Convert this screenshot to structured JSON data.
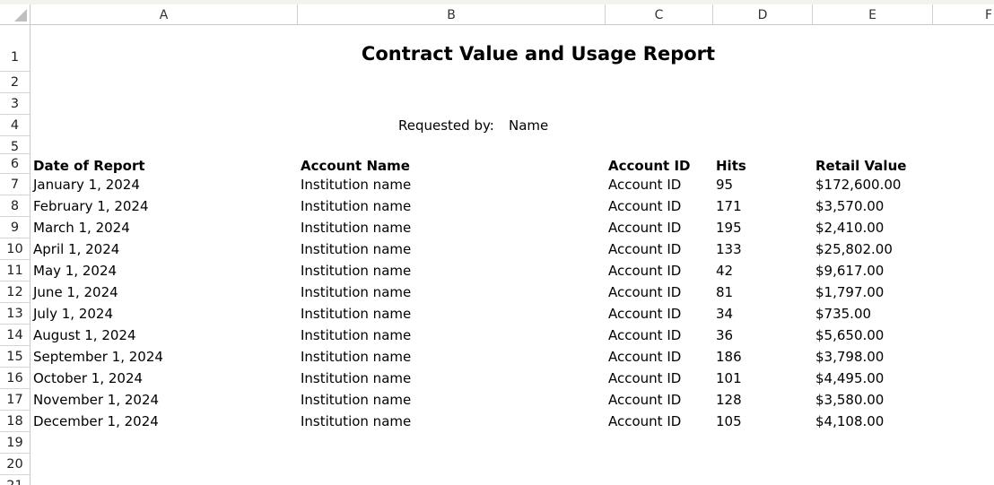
{
  "corner": {
    "icon": "select-all-triangle-icon"
  },
  "columns": [
    "A",
    "B",
    "C",
    "D",
    "E",
    "F"
  ],
  "rows": [
    "1",
    "2",
    "3",
    "4",
    "5",
    "6",
    "7",
    "8",
    "9",
    "10",
    "11",
    "12",
    "13",
    "14",
    "15",
    "16",
    "17",
    "18",
    "19",
    "20",
    "21"
  ],
  "report": {
    "title": "Contract Value and Usage Report",
    "requested_by_label": "Requested by:",
    "requested_by_value": "Name"
  },
  "table": {
    "headers": {
      "date": "Date of Report",
      "account_name": "Account Name",
      "account_id": "Account ID",
      "hits": "Hits",
      "retail_value": "Retail Value"
    },
    "rows": [
      {
        "date": "January 1, 2024",
        "account_name": "Institution name",
        "account_id": "Account ID",
        "hits": "95",
        "retail_value": "$172,600.00"
      },
      {
        "date": "February 1, 2024",
        "account_name": "Institution name",
        "account_id": "Account ID",
        "hits": "171",
        "retail_value": "$3,570.00"
      },
      {
        "date": "March 1, 2024",
        "account_name": "Institution name",
        "account_id": "Account ID",
        "hits": "195",
        "retail_value": "$2,410.00"
      },
      {
        "date": "April 1, 2024",
        "account_name": "Institution name",
        "account_id": "Account ID",
        "hits": "133",
        "retail_value": "$25,802.00"
      },
      {
        "date": "May 1, 2024",
        "account_name": "Institution name",
        "account_id": "Account ID",
        "hits": "42",
        "retail_value": "$9,617.00"
      },
      {
        "date": "June 1, 2024",
        "account_name": "Institution name",
        "account_id": "Account ID",
        "hits": "81",
        "retail_value": "$1,797.00"
      },
      {
        "date": "July 1, 2024",
        "account_name": "Institution name",
        "account_id": "Account ID",
        "hits": "34",
        "retail_value": "$735.00"
      },
      {
        "date": "August 1, 2024",
        "account_name": "Institution name",
        "account_id": "Account ID",
        "hits": "36",
        "retail_value": "$5,650.00"
      },
      {
        "date": "September 1, 2024",
        "account_name": "Institution name",
        "account_id": "Account ID",
        "hits": "186",
        "retail_value": "$3,798.00"
      },
      {
        "date": "October 1, 2024",
        "account_name": "Institution name",
        "account_id": "Account ID",
        "hits": "101",
        "retail_value": "$4,495.00"
      },
      {
        "date": "November 1, 2024",
        "account_name": "Institution name",
        "account_id": "Account ID",
        "hits": "128",
        "retail_value": "$3,580.00"
      },
      {
        "date": "December 1, 2024",
        "account_name": "Institution name",
        "account_id": "Account ID",
        "hits": "105",
        "retail_value": "$4,108.00"
      }
    ]
  }
}
